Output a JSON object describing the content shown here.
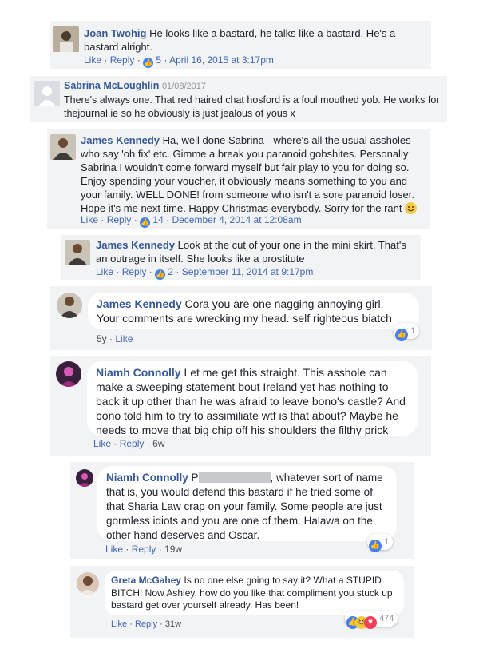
{
  "comments": [
    {
      "author": "Joan Twohig",
      "text": "He looks like a bastard, he talks like a bastard. He's a bastard alright.",
      "like": "Like",
      "reply": "Reply",
      "reactions": "5",
      "date": "April 16, 2015 at 3:17pm"
    },
    {
      "author": "Sabrina McLoughlin",
      "date": "01/08/2017",
      "text": "There's always one. That red haired chat hosford is a foul mouthed yob. He works for thejournal.ie so he obviously is just jealous of yous x"
    },
    {
      "author": "James Kennedy",
      "text": "Ha, well done Sabrina - where's all the usual assholes who say 'oh fix' etc. Gimme a break you paranoid gobshites. Personally Sabrina I wouldn't come forward myself but fair play to you for doing so. Enjoy spending your voucher, it obviously means something to you and your family. WELL DONE! from someone who isn't a sore paranoid loser. Hope it's me next time. Happy Christmas everybody. Sorry for the rant",
      "like": "Like",
      "reply": "Reply",
      "reactions": "14",
      "date": "December 4, 2014 at 12:08am"
    },
    {
      "author": "James Kennedy",
      "text": "Look at the cut of your one in the mini skirt. That's an outrage in itself. She looks like a prostitute",
      "like": "Like",
      "reply": "Reply",
      "reactions": "2",
      "date": "September 11, 2014 at 9:17pm"
    },
    {
      "author": "James Kennedy",
      "text": "Cora you are one nagging annoying girl. Your comments are wrecking my head. self righteous biatch",
      "age": "5y",
      "like": "Like",
      "reactions": "1"
    },
    {
      "author": "Niamh Connolly",
      "text": "Let me get this straight. This asshole can make a sweeping statement bout Ireland yet has nothing to back it up other than he was afraid to leave bono's castle? And bono told him to try to assimiliate wtf is that about? Maybe he needs to move that big chip off his shoulders the filthy prick",
      "like": "Like",
      "reply": "Reply",
      "age": "6w"
    },
    {
      "author": "Niamh Connolly",
      "text_start": "P",
      "text": ", whatever sort of name that is, you would defend this bastard if he tried some of that Sharia Law crap on your family. Some people are just gormless idiots and you are one of them. Halawa on the other hand deserves and Oscar.",
      "like": "Like",
      "reply": "Reply",
      "age": "19w",
      "reactions": "1"
    },
    {
      "author": "Greta McGahey",
      "text": "Is no one else going to say it? What a STUPID BITCH! Now Ashley, how do you like that compliment you stuck up bastard get over yourself already. Has been!",
      "like": "Like",
      "reply": "Reply",
      "age": "31w",
      "reactions": "474"
    }
  ],
  "separator": "·",
  "icons": {
    "like": "thumbs-up-icon",
    "haha": "haha-icon",
    "love": "love-icon",
    "smiley": "smiley-icon"
  },
  "colors": {
    "name": "#365899",
    "link": "#4267b2",
    "like_blue": "#4080ff",
    "panel": "#f2f3f5"
  }
}
